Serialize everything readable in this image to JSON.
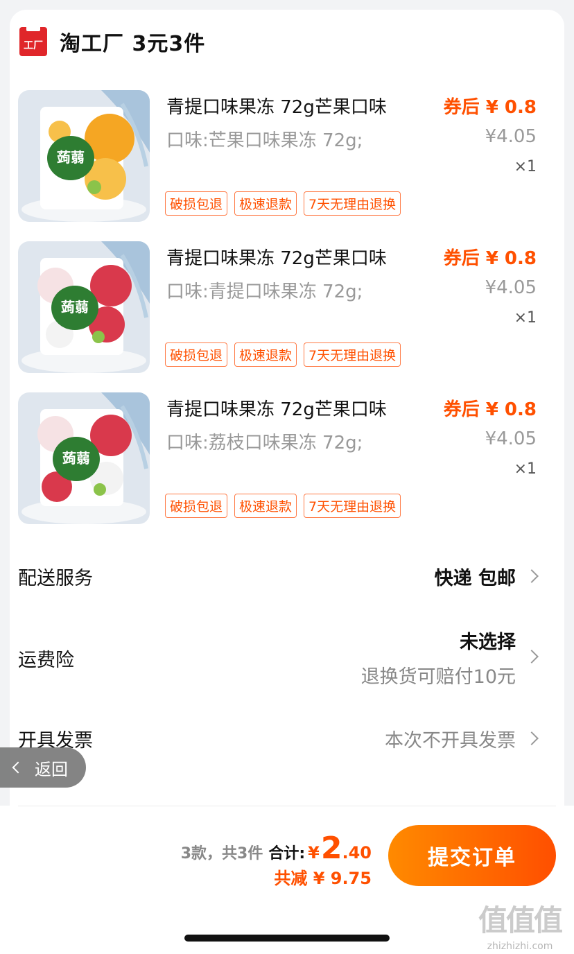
{
  "store": {
    "name": "淘工厂 3元3件",
    "logo_text": "工厂"
  },
  "items": [
    {
      "title": "青提口味果冻 72g芒果口味",
      "spec": "口味:芒果口味果冻 72g;",
      "price_after": "券后 ¥ 0.8",
      "price_orig": "¥4.05",
      "qty": "×1",
      "tags": [
        "破损包退",
        "极速退款",
        "7天无理由退换"
      ],
      "image": {
        "pack_text": "蒟蒻",
        "colors": {
          "bg": "#dfe6ee",
          "fruit": "#f5a623",
          "fruit2": "#f7c04a",
          "leaf": "#a9c4dc"
        }
      }
    },
    {
      "title": "青提口味果冻 72g芒果口味",
      "spec": "口味:青提口味果冻 72g;",
      "price_after": "券后 ¥ 0.8",
      "price_orig": "¥4.05",
      "qty": "×1",
      "tags": [
        "破损包退",
        "极速退款",
        "7天无理由退换"
      ],
      "image": {
        "pack_text": "蒟蒻",
        "colors": {
          "bg": "#dfe6ee",
          "fruit": "#d9394c",
          "fruit2": "#f3f3f3",
          "leaf": "#a9c4dc"
        }
      }
    },
    {
      "title": "青提口味果冻 72g芒果口味",
      "spec": "口味:荔枝口味果冻 72g;",
      "price_after": "券后 ¥ 0.8",
      "price_orig": "¥4.05",
      "qty": "×1",
      "tags": [
        "破损包退",
        "极速退款",
        "7天无理由退换"
      ],
      "image": {
        "pack_text": "蒟蒻",
        "colors": {
          "bg": "#dfe6ee",
          "fruit": "#d9394c",
          "fruit2": "#f3f3f3",
          "leaf": "#a9c4dc"
        }
      }
    }
  ],
  "delivery": {
    "label": "配送服务",
    "value": "快递 包邮"
  },
  "shipping_insurance": {
    "label": "运费险",
    "value": "未选择",
    "sub": "退换货可赔付10元"
  },
  "invoice": {
    "label": "开具发票",
    "value": "本次不开具发票"
  },
  "back": {
    "label": "返回"
  },
  "footer": {
    "count_text": "3款，共3件",
    "total_label": "合计:",
    "currency": "¥",
    "total_int": "2",
    "total_dec": ".40",
    "discount": "共减 ¥ 9.75",
    "submit_label": "提交订单"
  },
  "watermark": {
    "glyphs": "值值值",
    "url": "zhizhizhi.com"
  },
  "colors": {
    "accent": "#ff5000",
    "logo_red": "#e0262a",
    "submit_gradient": [
      "#ff8a00",
      "#ff4f00"
    ]
  }
}
